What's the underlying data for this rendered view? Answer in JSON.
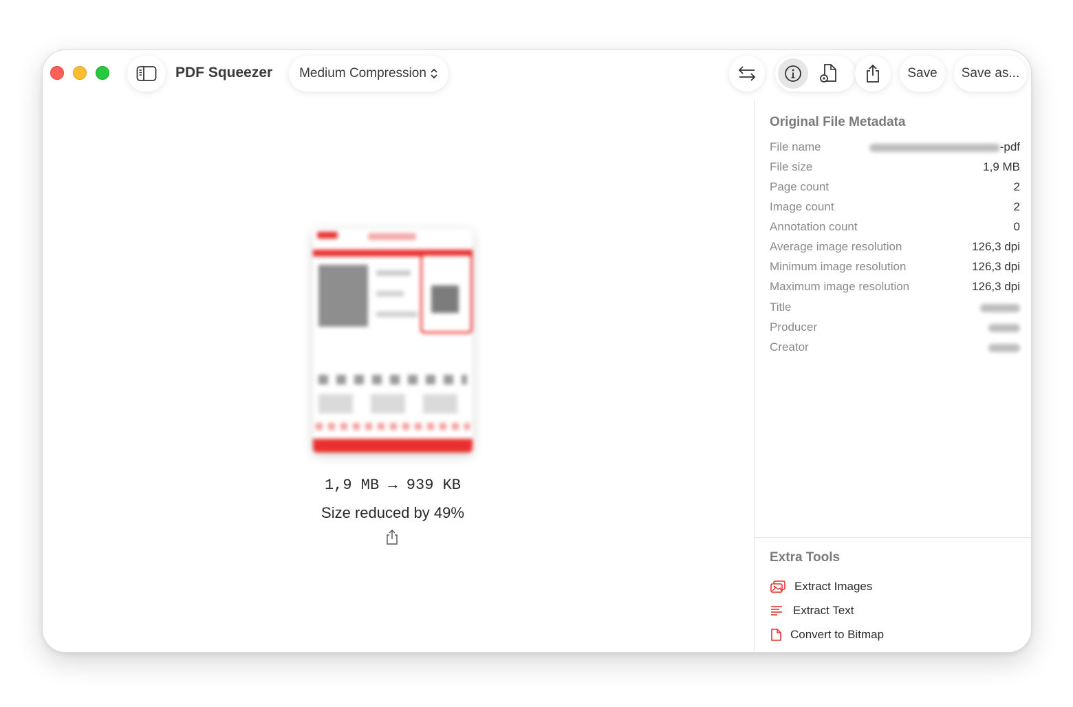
{
  "window": {
    "app_title": "PDF Squeezer",
    "compression_label": "Medium Compression"
  },
  "toolbar": {
    "save_label": "Save",
    "save_as_label": "Save as..."
  },
  "result": {
    "size_change": "1,9 MB → 939 KB",
    "reduction": "Size reduced by 49%"
  },
  "metadata": {
    "title": "Original File Metadata",
    "rows": [
      {
        "key": "File name",
        "value": "-pdf"
      },
      {
        "key": "File size",
        "value": "1,9 MB"
      },
      {
        "key": "Page count",
        "value": "2"
      },
      {
        "key": "Image count",
        "value": "2"
      },
      {
        "key": "Annotation count",
        "value": "0"
      },
      {
        "key": "Average image resolution",
        "value": "126,3 dpi"
      },
      {
        "key": "Minimum image resolution",
        "value": "126,3 dpi"
      },
      {
        "key": "Maximum image resolution",
        "value": "126,3 dpi"
      },
      {
        "key": "Title",
        "value": ""
      },
      {
        "key": "Producer",
        "value": ""
      },
      {
        "key": "Creator",
        "value": ""
      }
    ]
  },
  "extra_tools": {
    "title": "Extra Tools",
    "items": [
      {
        "label": "Extract Images",
        "icon": "photos-icon"
      },
      {
        "label": "Extract Text",
        "icon": "text-lines-icon"
      },
      {
        "label": "Convert to Bitmap",
        "icon": "document-icon"
      }
    ]
  },
  "colors": {
    "accent": "#e8312f",
    "close": "#fe5f57",
    "minimize": "#febc2e",
    "maximize": "#28c840"
  }
}
